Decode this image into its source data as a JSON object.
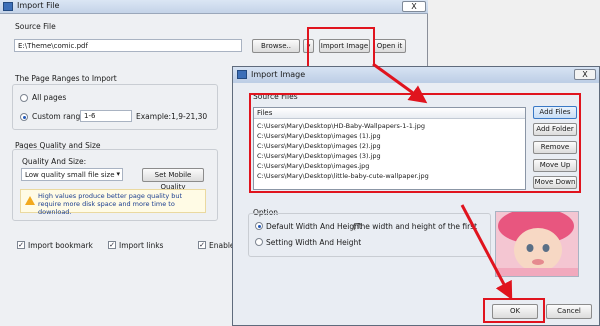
{
  "import_file": {
    "title": "Import File",
    "close": "X",
    "source_file_label": "Source File",
    "source_path": "E:\\Theme\\comic.pdf",
    "browse_label": "Browse..",
    "dropdown_arrow": "▾",
    "import_image_label": "Import Image",
    "open_it_label": "Open it",
    "page_ranges_label": "The Page Ranges to Import",
    "all_pages_label": "All pages",
    "custom_range_label": "Custom range:",
    "custom_range_value": "1-6",
    "example_text": "Example:1,9-21,30",
    "quality_group_label": "Pages Quality and Size",
    "quality_size_label": "Quality And Size:",
    "quality_select_value": "Low quality small file size",
    "mobile_quality_label": "Set Mobile Quality",
    "warning_text": "High values produce better page quality but require more disk space and more time to download.",
    "import_bookmark_label": "Import bookmark",
    "import_links_label": "Import links",
    "enable_label": "Enable s"
  },
  "import_image": {
    "title": "Import Image",
    "close": "X",
    "source_files_label": "Source Files",
    "files_header": "Files",
    "files": [
      "C:\\Users\\Mary\\Desktop\\HD-Baby-Wallpapers-1-1.jpg",
      "C:\\Users\\Mary\\Desktop\\images (1).jpg",
      "C:\\Users\\Mary\\Desktop\\images (2).jpg",
      "C:\\Users\\Mary\\Desktop\\images (3).jpg",
      "C:\\Users\\Mary\\Desktop\\images.jpg",
      "C:\\Users\\Mary\\Desktop\\little-baby-cute-wallpaper.jpg"
    ],
    "add_files_label": "Add Files",
    "add_folder_label": "Add Folder",
    "remove_label": "Remove",
    "move_up_label": "Move Up",
    "move_down_label": "Move Down",
    "option_label": "Option",
    "default_size_label": "Default Width And Height",
    "default_size_note": "(The width and height of the first picture)",
    "setting_size_label": "Setting Width And Height",
    "ok_label": "OK",
    "cancel_label": "Cancel"
  },
  "colors": {
    "highlight": "#e0141e",
    "arrow": "#e0141e"
  }
}
